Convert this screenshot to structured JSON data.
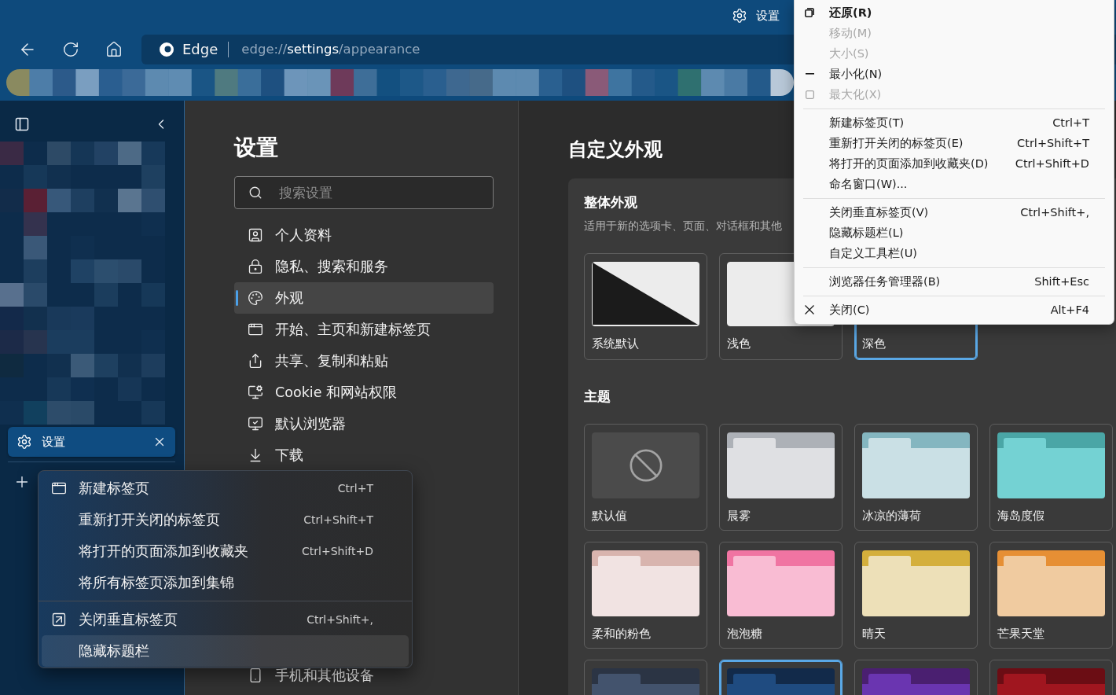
{
  "window": {
    "title": "设置"
  },
  "toolbar": {
    "site_name": "Edge",
    "url": "edge://**settings**/appearance"
  },
  "vertical_tabs": {
    "tabs": [
      {
        "title": "设置",
        "selected": true
      }
    ]
  },
  "settings_nav": {
    "title": "设置",
    "search": {
      "placeholder": "搜索设置"
    },
    "items": [
      {
        "label": "个人资料",
        "selected": false
      },
      {
        "label": "隐私、搜索和服务",
        "selected": false
      },
      {
        "label": "外观",
        "selected": true
      },
      {
        "label": "开始、主页和新建标签页",
        "selected": false
      },
      {
        "label": "共享、复制和粘贴",
        "selected": false
      },
      {
        "label": "Cookie 和网站权限",
        "selected": false
      },
      {
        "label": "默认浏览器",
        "selected": false
      },
      {
        "label": "下载",
        "selected": false
      },
      {
        "label": "手机和其他设备",
        "selected": false
      }
    ]
  },
  "content": {
    "title": "自定义外观",
    "overall": {
      "title": "整体外观",
      "description": "适用于新的选项卡、页面、对话框和其他",
      "modes": [
        {
          "kind": "system",
          "label": "系统默认",
          "selected": false
        },
        {
          "kind": "light",
          "label": "浅色",
          "selected": false
        },
        {
          "label": "深色",
          "selected": true
        }
      ]
    },
    "themes_title": "主题",
    "themes": [
      {
        "kind": "none",
        "label": "默认值",
        "selected": false
      },
      {
        "kind": "folder",
        "label": "晨雾",
        "color": "#adb1b7",
        "page": {
          "color": "#dfe0e3"
        },
        "selected": false
      },
      {
        "kind": "folder",
        "label": "冰凉的薄荷",
        "color": "#84b6c0",
        "page": {
          "color": "#cae0e5"
        },
        "selected": false
      },
      {
        "kind": "folder",
        "label": "海岛度假",
        "color": "#4aa6a6",
        "page": {
          "color": "#74d2d3"
        },
        "selected": false
      },
      {
        "kind": "folder",
        "label": "柔和的粉色",
        "color": "#d8b4ae",
        "page": {
          "color": "#f1e3e2"
        },
        "selected": false
      },
      {
        "kind": "folder",
        "label": "泡泡糖",
        "color": "#f074a2",
        "page": {
          "color": "#f9bcd3"
        },
        "selected": false
      },
      {
        "kind": "folder",
        "label": "晴天",
        "color": "#d4af3c",
        "page": {
          "color": "#ede0b8"
        },
        "selected": false
      },
      {
        "kind": "folder",
        "label": "芒果天堂",
        "color": "#e68f34",
        "page": {
          "color": "#f0cba0"
        },
        "selected": false
      },
      {
        "kind": "folder",
        "color": "#2b3444",
        "page": {
          "color": "#43536d"
        },
        "selected": false
      },
      {
        "kind": "folder",
        "color": "#122a4a",
        "page": {
          "color": "#1f4b80"
        },
        "selected": true
      },
      {
        "kind": "folder",
        "color": "#4a1f70",
        "page": {
          "color": "#6a35b0"
        },
        "selected": false
      },
      {
        "kind": "folder",
        "color": "#6b0d14",
        "page": {
          "color": "#a0161f"
        },
        "selected": false
      }
    ]
  },
  "tab_menu": {
    "groups": [
      [
        {
          "kind": "newtab",
          "label": "新建标签页",
          "shortcut": "Ctrl+T",
          "highlighted": false
        },
        {
          "kind": "plain",
          "label": "重新打开关闭的标签页",
          "shortcut": "Ctrl+Shift+T",
          "highlighted": false
        },
        {
          "kind": "plain",
          "label": "将打开的页面添加到收藏夹",
          "shortcut": "Ctrl+Shift+D",
          "highlighted": false
        },
        {
          "kind": "plain",
          "label": "将所有标签页添加到集锦",
          "highlighted": false
        }
      ],
      [
        {
          "kind": "verticaltabs",
          "label": "关闭垂直标签页",
          "shortcut": "Ctrl+Shift+,",
          "highlighted": false
        },
        {
          "kind": "plain",
          "label": "隐藏标题栏",
          "highlighted": true
        }
      ]
    ]
  },
  "system_menu": {
    "groups": [
      [
        {
          "kind": "restore",
          "label": "还原(R)",
          "default": true,
          "disabled": false
        },
        {
          "kind": "plain",
          "label": "移动(M)",
          "default": false,
          "disabled": true
        },
        {
          "kind": "plain",
          "label": "大小(S)",
          "default": false,
          "disabled": true
        },
        {
          "kind": "minimize",
          "label": "最小化(N)",
          "default": false,
          "disabled": false
        },
        {
          "kind": "maximize",
          "label": "最大化(X)",
          "default": false,
          "disabled": true
        }
      ],
      [
        {
          "kind": "plain",
          "label": "新建标签页(T)",
          "shortcut": "Ctrl+T",
          "default": false,
          "disabled": false
        },
        {
          "kind": "plain",
          "label": "重新打开关闭的标签页(E)",
          "shortcut": "Ctrl+Shift+T",
          "default": false,
          "disabled": false
        },
        {
          "kind": "plain",
          "label": "将打开的页面添加到收藏夹(D)",
          "shortcut": "Ctrl+Shift+D",
          "default": false,
          "disabled": false
        },
        {
          "kind": "plain",
          "label": "命名窗口(W)...",
          "default": false,
          "disabled": false
        }
      ],
      [
        {
          "kind": "plain",
          "label": "关闭垂直标签页(V)",
          "shortcut": "Ctrl+Shift+,",
          "default": false,
          "disabled": false
        },
        {
          "kind": "plain",
          "label": "隐藏标题栏(L)",
          "default": false,
          "disabled": false
        },
        {
          "kind": "plain",
          "label": "自定义工具栏(U)",
          "default": false,
          "disabled": false
        }
      ],
      [
        {
          "kind": "plain",
          "label": "浏览器任务管理器(B)",
          "shortcut": "Shift+Esc",
          "default": false,
          "disabled": false
        }
      ],
      [
        {
          "kind": "close",
          "label": "关闭(C)",
          "shortcut": "Alt+F4",
          "default": false,
          "disabled": false
        }
      ]
    ]
  }
}
